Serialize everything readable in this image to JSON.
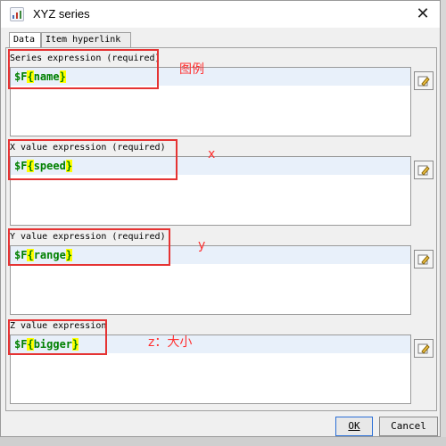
{
  "window": {
    "title": "XYZ series",
    "close_glyph": "✕"
  },
  "tabs": [
    {
      "label": "Data",
      "active": true
    },
    {
      "label": "Item hyperlink",
      "active": false
    }
  ],
  "sections": [
    {
      "label": "Series expression (required)",
      "expr_prefix": "$F",
      "expr_open": "{",
      "expr_field": "name",
      "expr_close": "}",
      "annotation": "图例"
    },
    {
      "label": "X value expression (required)",
      "expr_prefix": "$F",
      "expr_open": "{",
      "expr_field": "speed",
      "expr_close": "}",
      "annotation": "x"
    },
    {
      "label": "Y value expression (required)",
      "expr_prefix": "$F",
      "expr_open": "{",
      "expr_field": "range",
      "expr_close": "}",
      "annotation": "y"
    },
    {
      "label": "Z value expression",
      "expr_prefix": "$F",
      "expr_open": "{",
      "expr_field": "bigger",
      "expr_close": "}",
      "annotation": "z：大小"
    }
  ],
  "buttons": {
    "ok_label": "OK",
    "cancel_label": "Cancel"
  },
  "icons": {
    "app": "report-icon",
    "edit": "pencil-edit-icon",
    "close": "close-icon"
  },
  "colors": {
    "annotation_red": "#e53333",
    "expr_green": "#008000",
    "brace_highlight": "#ffff00",
    "line_highlight": "#e8f0fa"
  }
}
